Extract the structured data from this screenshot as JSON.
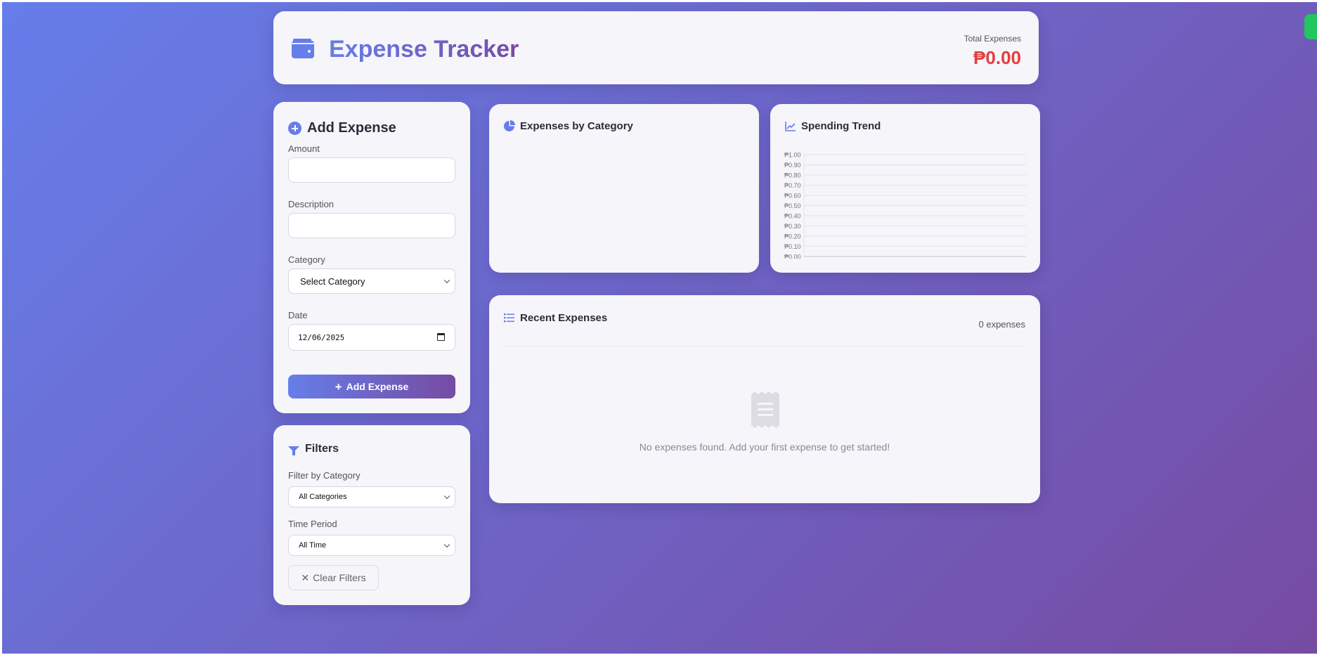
{
  "header": {
    "title": "Expense Tracker",
    "total_label": "Total Expenses",
    "total_value": "₱0.00"
  },
  "add_expense": {
    "title": "Add Expense",
    "amount_label": "Amount",
    "amount_value": "",
    "description_label": "Description",
    "description_value": "",
    "category_label": "Category",
    "category_selected": "Select Category",
    "date_label": "Date",
    "date_value": "12/06/2025",
    "submit_label": "Add Expense"
  },
  "filters": {
    "title": "Filters",
    "category_label": "Filter by Category",
    "category_selected": "All Categories",
    "period_label": "Time Period",
    "period_selected": "All Time",
    "clear_label": "Clear Filters"
  },
  "category_chart": {
    "title": "Expenses by Category"
  },
  "trend_chart": {
    "title": "Spending Trend"
  },
  "chart_data": [
    {
      "type": "pie",
      "title": "Expenses by Category",
      "categories": [],
      "values": []
    },
    {
      "type": "line",
      "title": "Spending Trend",
      "x": [],
      "series": [],
      "ylim": [
        0,
        1
      ],
      "yticks": [
        "₱1.00",
        "₱0.90",
        "₱0.80",
        "₱0.70",
        "₱0.60",
        "₱0.50",
        "₱0.40",
        "₱0.30",
        "₱0.20",
        "₱0.10",
        "₱0.00"
      ],
      "grid": true
    }
  ],
  "recent": {
    "title": "Recent Expenses",
    "count": "0 expenses",
    "empty_message": "No expenses found. Add your first expense to get started!"
  },
  "colors": {
    "accent": "#667eea",
    "accent_end": "#764ba2",
    "total": "#e53e3e"
  }
}
